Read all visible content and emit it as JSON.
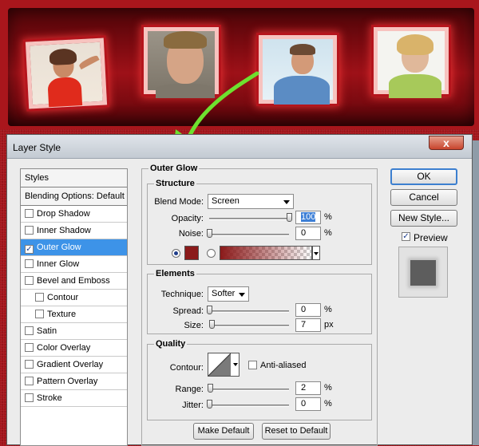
{
  "dialog": {
    "title": "Layer Style",
    "close_label": "x"
  },
  "sidebar": {
    "header": "Styles",
    "blending": "Blending Options: Default",
    "items": [
      {
        "label": "Drop Shadow",
        "checked": false
      },
      {
        "label": "Inner Shadow",
        "checked": false
      },
      {
        "label": "Outer Glow",
        "checked": true
      },
      {
        "label": "Inner Glow",
        "checked": false
      },
      {
        "label": "Bevel and Emboss",
        "checked": false
      },
      {
        "label": "Contour",
        "checked": false
      },
      {
        "label": "Texture",
        "checked": false
      },
      {
        "label": "Satin",
        "checked": false
      },
      {
        "label": "Color Overlay",
        "checked": false
      },
      {
        "label": "Gradient Overlay",
        "checked": false
      },
      {
        "label": "Pattern Overlay",
        "checked": false
      },
      {
        "label": "Stroke",
        "checked": false
      }
    ]
  },
  "outer_glow": {
    "title": "Outer Glow",
    "structure": {
      "title": "Structure",
      "blend_mode_label": "Blend Mode:",
      "blend_mode": "Screen",
      "opacity_label": "Opacity:",
      "opacity": "100",
      "opacity_fraction": 1.0,
      "noise_label": "Noise:",
      "noise": "0",
      "noise_fraction": 0.0,
      "pct": "%",
      "glow_color": "#8b1a1a"
    },
    "elements": {
      "title": "Elements",
      "technique_label": "Technique:",
      "technique": "Softer",
      "spread_label": "Spread:",
      "spread": "0",
      "spread_fraction": 0.0,
      "size_label": "Size:",
      "size": "7",
      "size_fraction": 0.03,
      "pct": "%",
      "px": "px"
    },
    "quality": {
      "title": "Quality",
      "contour_label": "Contour:",
      "anti_aliased_label": "Anti-aliased",
      "range_label": "Range:",
      "range": "2",
      "range_fraction": 0.01,
      "jitter_label": "Jitter:",
      "jitter": "0",
      "jitter_fraction": 0.0,
      "pct": "%"
    },
    "make_default": "Make Default",
    "reset_default": "Reset to Default"
  },
  "buttons": {
    "ok": "OK",
    "cancel": "Cancel",
    "new_style": "New Style...",
    "preview": "Preview",
    "preview_checked": true
  },
  "colors": {
    "accent": "#3d93e8",
    "banner": "#a9161c",
    "arrow": "#6ee12f"
  }
}
